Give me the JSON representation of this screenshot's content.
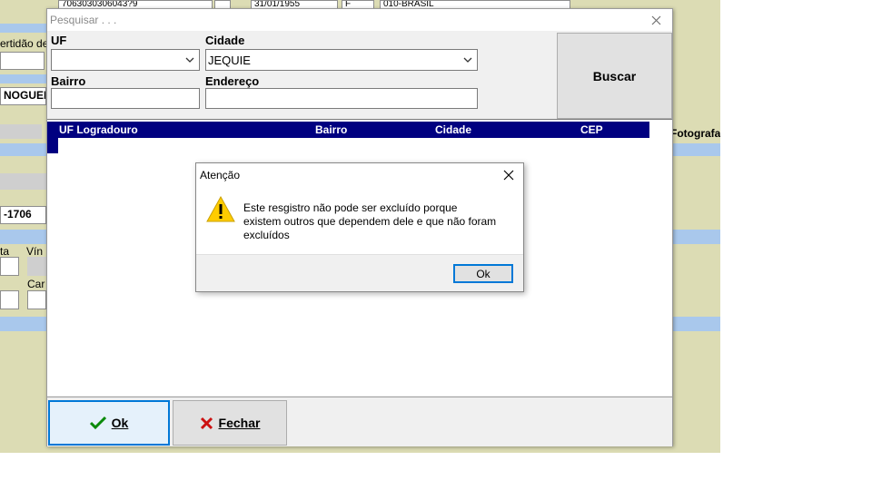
{
  "background_app": {
    "field_top_1": "7063030306043?9",
    "field_top_2": "31/01/1955",
    "field_top_3": "F",
    "field_top_4": "010-BRASIL",
    "certidao_label": "ertidão de",
    "name_partial": "NOGUEI",
    "fotografa_label": "Fotografa",
    "cep_partial": "-1706",
    "label_ta": "ta",
    "label_vin": "Vín",
    "label_car": "Car"
  },
  "dialog": {
    "title": "Pesquisar . . .",
    "uf_label": "UF",
    "uf_value": "",
    "cidade_label": "Cidade",
    "cidade_value": "JEQUIE",
    "bairro_label": "Bairro",
    "bairro_value": "",
    "endereco_label": "Endereço",
    "endereco_value": "",
    "buscar_label": "Buscar",
    "grid_columns": [
      "UF Logradouro",
      "Bairro",
      "Cidade",
      "CEP"
    ],
    "ok_label": "Ok",
    "fechar_label": "Fechar"
  },
  "message_box": {
    "title": "Atenção",
    "text_line1": "Este resgistro não pode ser excluído porque",
    "text_line2": "existem outros que dependem dele e que não foram",
    "text_line3": "excluídos",
    "ok_label": "Ok"
  },
  "colors": {
    "grid_header": "#000080",
    "focus_border": "#0078d7",
    "background_app": "#dcdcb4",
    "background_band": "#a9c8ec",
    "ok_check": "#0a8a0a",
    "close_x": "#cc1111",
    "warning": "#ffcc00"
  },
  "icons": {
    "ok_button": "checkmark-icon",
    "fechar_button": "close-x-icon",
    "message": "warning-icon"
  }
}
